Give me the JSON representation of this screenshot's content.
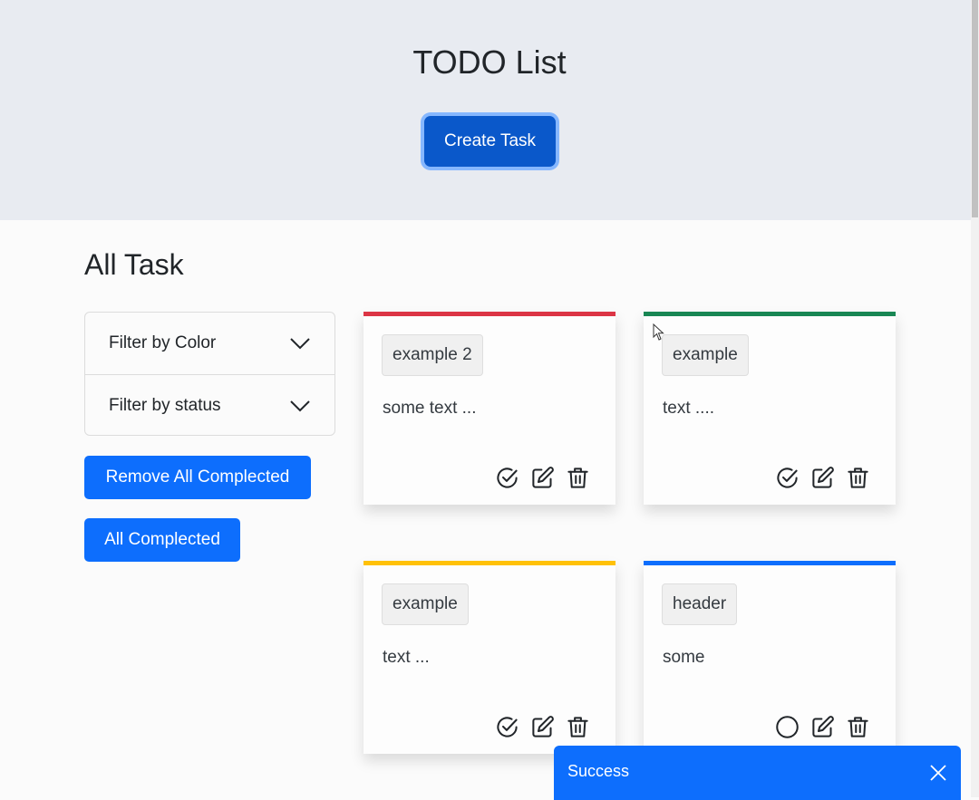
{
  "header": {
    "title": "TODO List",
    "create_button": "Create Task"
  },
  "section": {
    "title": "All Task"
  },
  "filters": [
    {
      "label": "Filter by Color",
      "icon": "chevron-down-icon"
    },
    {
      "label": "Filter by status",
      "icon": "chevron-down-icon"
    }
  ],
  "actions": {
    "remove_completed": "Remove All Complected",
    "all_completed": "All Complected"
  },
  "tasks": [
    {
      "header": "example 2",
      "text": "some text ...",
      "color": "#dc3545",
      "completed": true
    },
    {
      "header": "example",
      "text": "text ....",
      "color": "#198754",
      "completed": true
    },
    {
      "header": "example",
      "text": "text ...",
      "color": "#ffc107",
      "completed": true
    },
    {
      "header": "header",
      "text": "some",
      "color": "#0d6efd",
      "completed": false
    }
  ],
  "toast": {
    "message": "Success"
  },
  "colors": {
    "primary": "#0d6efd",
    "primary_dark": "#0a58ca",
    "hero_bg": "#e8ebf1"
  }
}
